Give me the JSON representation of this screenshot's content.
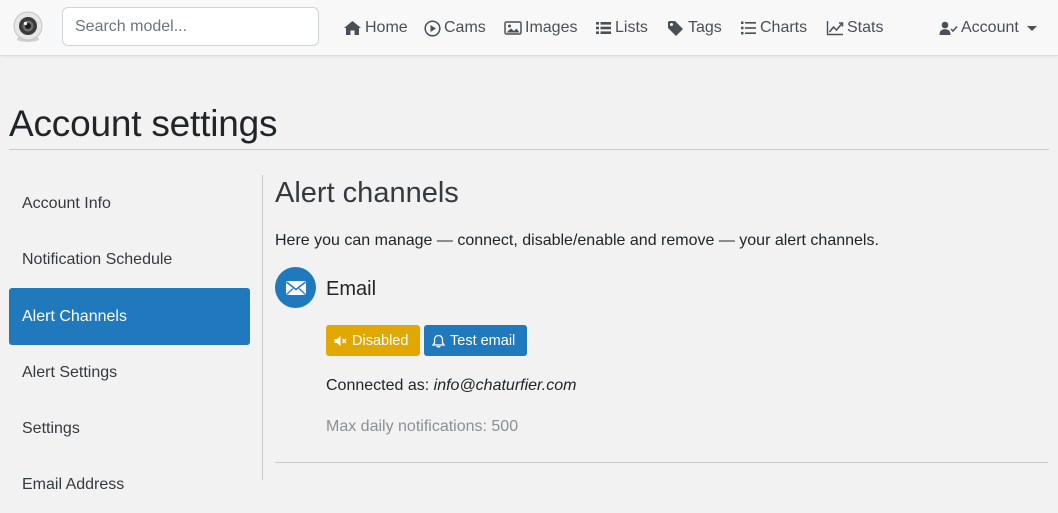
{
  "navbar": {
    "search_placeholder": "Search model...",
    "links": {
      "home": "Home",
      "cams": "Cams",
      "images": "Images",
      "lists": "Lists",
      "tags": "Tags",
      "charts": "Charts",
      "stats": "Stats",
      "account": "Account"
    }
  },
  "page": {
    "title": "Account settings"
  },
  "sidebar": {
    "items": [
      {
        "label": "Account Info"
      },
      {
        "label": "Notification Schedule"
      },
      {
        "label": "Alert Channels"
      },
      {
        "label": "Alert Settings"
      },
      {
        "label": "Settings"
      },
      {
        "label": "Email Address"
      }
    ],
    "active_index": 2
  },
  "content": {
    "title": "Alert channels",
    "description": "Here you can manage — connect, disable/enable and remove — your alert channels.",
    "channel": {
      "name": "Email",
      "disabled_label": "Disabled",
      "test_label": "Test email",
      "connected_prefix": "Connected as:",
      "connected_email": "info@chaturfier.com",
      "max_daily": "Max daily notifications: 500"
    }
  },
  "colors": {
    "primary": "#2079bc",
    "warning": "#e0a800",
    "background": "#f2f2f2"
  }
}
